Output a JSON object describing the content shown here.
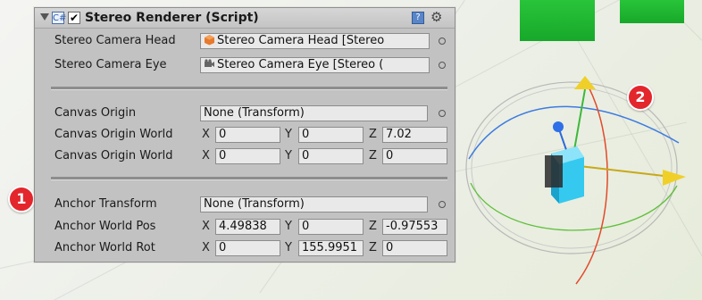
{
  "component": {
    "title": "Stereo Renderer (Script)",
    "enabled": "✔",
    "help_glyph": "?",
    "gear_glyph": "⚙",
    "script_glyph": "C#"
  },
  "properties": {
    "stereo_camera_head": {
      "label": "Stereo Camera Head",
      "value": "Stereo Camera Head [Stereo"
    },
    "stereo_camera_eye": {
      "label": "Stereo Camera Eye",
      "value": "Stereo Camera Eye [Stereo ("
    },
    "canvas_origin": {
      "label": "Canvas Origin",
      "value": "None (Transform)"
    },
    "canvas_origin_world_pos": {
      "label": "Canvas Origin World",
      "x": "0",
      "y": "0",
      "z": "7.02"
    },
    "canvas_origin_world_rot": {
      "label": "Canvas Origin World",
      "x": "0",
      "y": "0",
      "z": "0"
    },
    "anchor_transform": {
      "label": "Anchor Transform",
      "value": "None (Transform)"
    },
    "anchor_world_pos": {
      "label": "Anchor World Pos",
      "x": "4.49838",
      "y": "0",
      "z": "-0.97553"
    },
    "anchor_world_rot": {
      "label": "Anchor World Rot",
      "x": "0",
      "y": "155.9951",
      "z": "0"
    }
  },
  "axes": {
    "x": "X",
    "y": "Y",
    "z": "Z"
  },
  "callouts": {
    "one": "1",
    "two": "2"
  },
  "colors": {
    "panel": "#c2c2c2",
    "field": "#e9e9e9",
    "badge": "#e3262c",
    "cube": "#35c9ef",
    "green_object": "#1fb830"
  }
}
